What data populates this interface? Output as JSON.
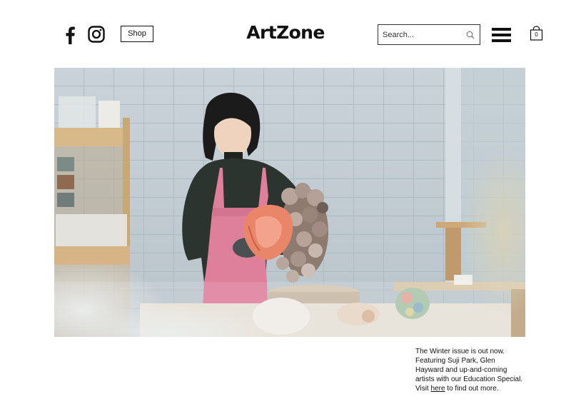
{
  "header": {
    "social": [
      {
        "name": "facebook-icon"
      },
      {
        "name": "instagram-icon"
      }
    ],
    "shop_label": "Shop",
    "logo_text": "ArtZone",
    "search": {
      "placeholder": "Search...",
      "icon": "search-icon"
    },
    "menu_icon": "hamburger-menu-icon",
    "cart": {
      "icon": "shopping-bag-icon",
      "count": "0"
    }
  },
  "hero": {
    "alt": "Ceramic artist in a pink apron holding a large textured ceramic sculpture in a studio"
  },
  "caption": {
    "line1": "The Winter issue is out now.",
    "line2": "Featuring Suji Park, Glen",
    "line3": "Hayward and up-and-coming",
    "line4": "artists with our Education Special.",
    "visit_prefix": "Visit ",
    "link_text": "here",
    "visit_suffix": " to find out more."
  },
  "colors": {
    "text": "#111111",
    "background": "#ffffff",
    "apron": "#de7f9c",
    "wall": "#c4cfd5"
  }
}
